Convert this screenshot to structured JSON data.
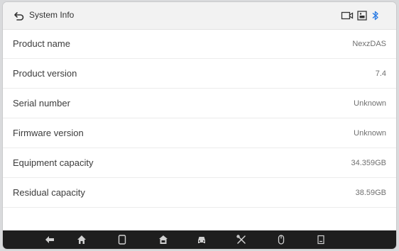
{
  "header": {
    "title": "System Info",
    "icons": [
      "back-icon",
      "video-icon",
      "image-icon",
      "bluetooth-icon"
    ]
  },
  "info_rows": [
    {
      "label": "Product name",
      "value": "NexzDAS"
    },
    {
      "label": "Product version",
      "value": "7.4"
    },
    {
      "label": "Serial number",
      "value": "Unknown"
    },
    {
      "label": "Firmware version",
      "value": "Unknown"
    },
    {
      "label": "Equipment capacity",
      "value": "34.359GB"
    },
    {
      "label": "Residual capacity",
      "value": "38.59GB"
    }
  ],
  "bottom_nav": {
    "icons": [
      "back-arrow-icon",
      "home-icon",
      "recent-apps-icon",
      "shop-icon",
      "vehicle-icon",
      "tools-icon",
      "mouse-icon",
      "screenshot-icon"
    ]
  },
  "colors": {
    "header_bg": "#f2f2f2",
    "bottom_bar_bg": "#1e1e1e",
    "bluetooth": "#2a7be4"
  }
}
